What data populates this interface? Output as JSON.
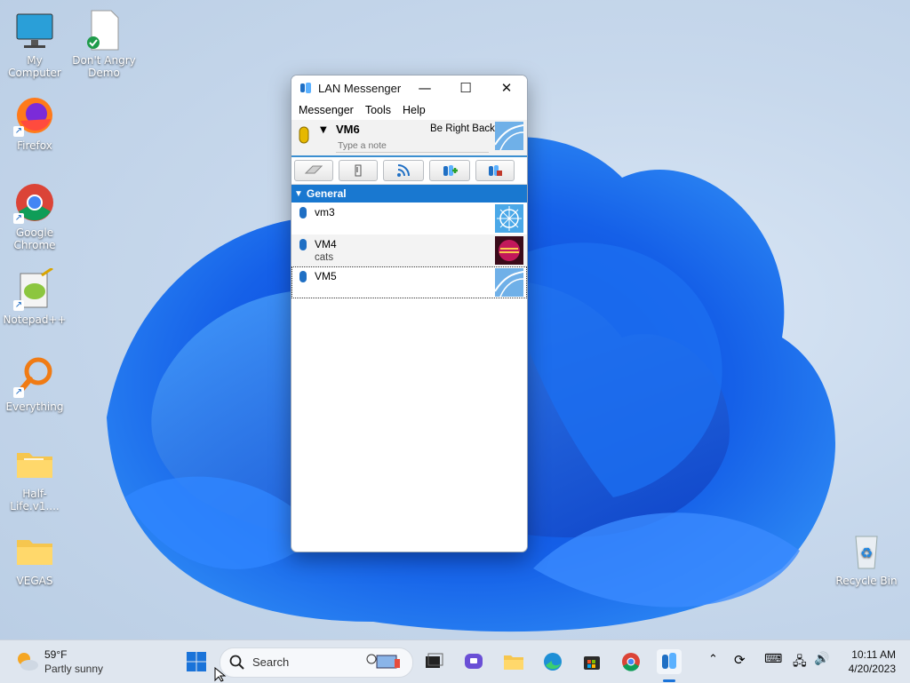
{
  "desktop": {
    "icons": [
      {
        "label": "My Computer"
      },
      {
        "label": "Don't Angry Demo"
      },
      {
        "label": "Firefox"
      },
      {
        "label": "Google Chrome"
      },
      {
        "label": "Notepad++"
      },
      {
        "label": "Everything"
      },
      {
        "label": "Half-Life.v1...."
      },
      {
        "label": "VEGAS"
      },
      {
        "label": "Recycle Bin"
      }
    ]
  },
  "window": {
    "title": "LAN Messenger",
    "menu": [
      "Messenger",
      "Tools",
      "Help"
    ],
    "profile": {
      "name": "VM6",
      "status": "Be Right Back",
      "note_placeholder": "Type a note"
    },
    "group": "General",
    "contacts": [
      {
        "name": "vm3",
        "note": ""
      },
      {
        "name": "VM4",
        "note": "cats"
      },
      {
        "name": "VM5",
        "note": ""
      }
    ]
  },
  "taskbar": {
    "weather_temp": "59°F",
    "weather_desc": "Partly sunny",
    "search_placeholder": "Search",
    "time": "10:11 AM",
    "date": "4/20/2023"
  }
}
